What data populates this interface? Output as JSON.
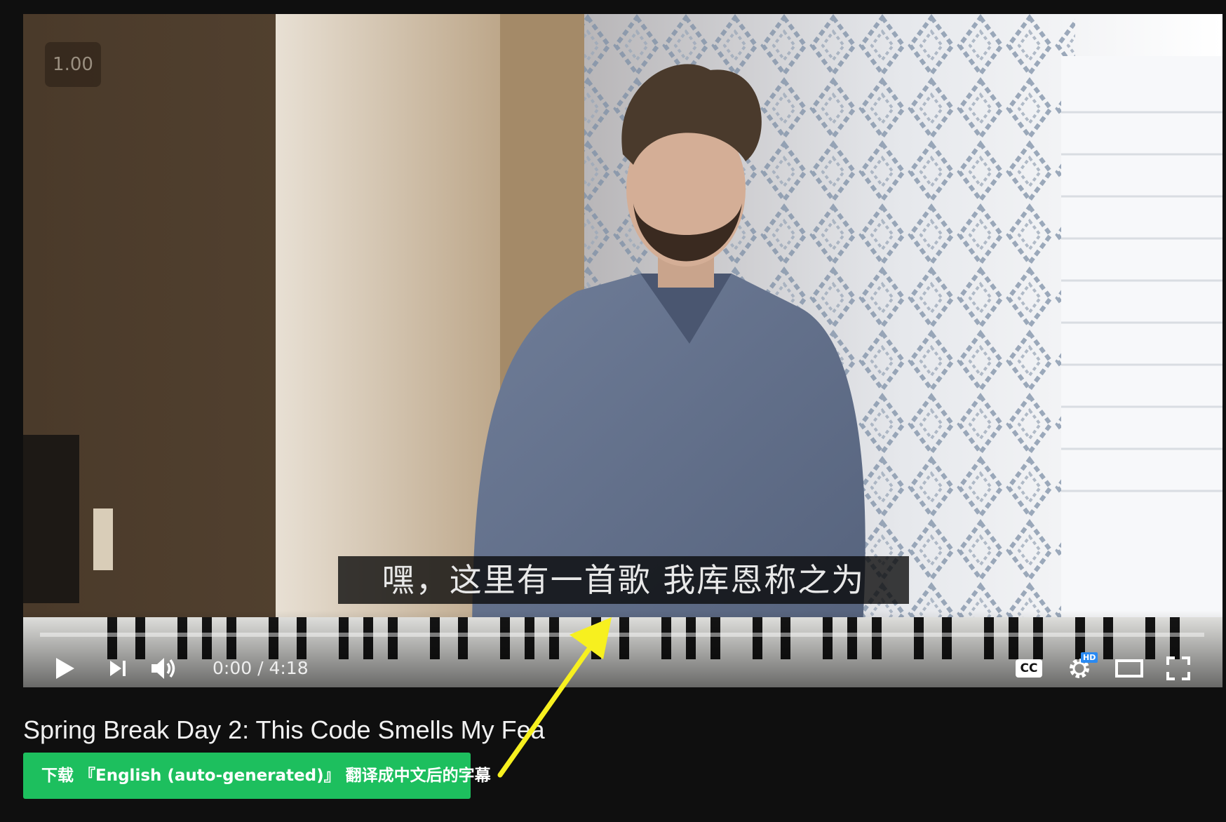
{
  "player": {
    "speed_badge": "1.00",
    "subtitle": "嘿，这里有一首歌 我库恩称之为",
    "progress": 0,
    "time_display": "0:00 / 4:18",
    "controls": {
      "play_icon": "play-icon",
      "next_icon": "skip-next-icon",
      "volume_icon": "volume-icon",
      "cc_label": "CC",
      "hd_badge": "HD",
      "settings_icon": "gear-icon",
      "theater_icon": "theater-mode-icon",
      "fullscreen_icon": "fullscreen-icon"
    }
  },
  "video": {
    "title": "Spring Break Day 2: This Code Smells My Fea"
  },
  "download_button": {
    "label": "下载 『English (auto-generated)』 翻译成中文后的字幕"
  },
  "annotation": {
    "arrow_color": "#f7f01f"
  },
  "colors": {
    "page_bg": "#0f0f0f",
    "button_green": "#1dbf5e",
    "progress_red": "#ff0000"
  }
}
